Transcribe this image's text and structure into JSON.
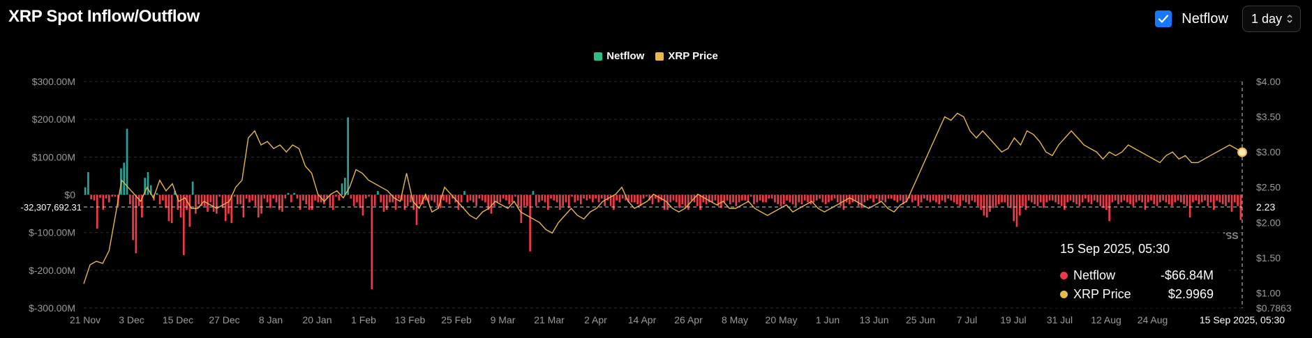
{
  "header": {
    "title": "XRP Spot Inflow/Outflow",
    "netflow_toggle_label": "Netflow",
    "netflow_checked": true,
    "interval_value": "1 day"
  },
  "colors": {
    "netflow_positive": "#26a69a",
    "netflow_negative": "#ef3b48",
    "price_line": "#e8b84a",
    "checkbox": "#1677ff"
  },
  "legend": [
    {
      "label": "Netflow",
      "color": "#2ebd85"
    },
    {
      "label": "XRP Price",
      "color": "#e8b84a"
    }
  ],
  "tooltip": {
    "time": "15 Sep 2025, 05:30",
    "rows": [
      {
        "label": "Netflow",
        "value": "-$66.84M",
        "color": "#ef3b48"
      },
      {
        "label": "XRP Price",
        "value": "$2.9969",
        "color": "#e8b84a"
      }
    ]
  },
  "crosshair": {
    "y_label": "-32,307,692.31",
    "price_label": "2.23",
    "x_label": "15 Sep 2025, 05:30",
    "price_axis_min_label": "$0.7863"
  },
  "watermark": "ISS",
  "chart_data": {
    "type": "bar",
    "title": "XRP Spot Inflow/Outflow",
    "x_tick_labels": [
      "21 Nov",
      "3 Dec",
      "15 Dec",
      "27 Dec",
      "8 Jan",
      "20 Jan",
      "1 Feb",
      "13 Feb",
      "25 Feb",
      "9 Mar",
      "21 Mar",
      "2 Apr",
      "14 Apr",
      "26 Apr",
      "8 May",
      "20 May",
      "1 Jun",
      "13 Jun",
      "25 Jun",
      "7 Jul",
      "19 Jul",
      "31 Jul",
      "12 Aug",
      "24 Aug"
    ],
    "left_axis": {
      "ticks": [
        300,
        200,
        100,
        0,
        -100,
        -200,
        -300
      ],
      "tick_labels": [
        "$300.00M",
        "$200.00M",
        "$100.00M",
        "$0",
        "$-100.00M",
        "$-200.00M",
        "$-300.00M"
      ],
      "ylim": [
        -300,
        300
      ],
      "unit": "M USD"
    },
    "right_axis": {
      "ticks": [
        4.0,
        3.5,
        3.0,
        2.5,
        2.0,
        1.5,
        1.0
      ],
      "tick_labels": [
        "$4.00",
        "$3.50",
        "$3.00",
        "$2.50",
        "$2.00",
        "$1.50",
        "$1.00"
      ],
      "ylim": [
        0.7863,
        4.0
      ]
    },
    "grid": true,
    "legend_position": "top-center",
    "series": [
      {
        "name": "Netflow",
        "axis": "left",
        "kind": "bar",
        "values": [
          20,
          60,
          -12,
          -15,
          -90,
          -8,
          -40,
          -10,
          -20,
          -5,
          -5,
          -30,
          70,
          85,
          175,
          -25,
          -120,
          -155,
          -30,
          -60,
          45,
          60,
          25,
          -15,
          5,
          -25,
          -15,
          -35,
          -70,
          -75,
          10,
          -40,
          -60,
          -160,
          -40,
          -85,
          35,
          -50,
          -25,
          -30,
          -30,
          -45,
          -20,
          -45,
          -50,
          -5,
          -35,
          -70,
          -50,
          -75,
          -5,
          -25,
          -25,
          -60,
          -10,
          -20,
          -15,
          -30,
          -60,
          -50,
          -10,
          -20,
          -35,
          -10,
          -20,
          -40,
          -45,
          -10,
          5,
          -20,
          5,
          -10,
          -40,
          -15,
          -25,
          -40,
          -40,
          -15,
          -20,
          -20,
          -25,
          -10,
          -30,
          -40,
          -5,
          -15,
          30,
          45,
          205,
          -10,
          -30,
          -20,
          -35,
          -55,
          -10,
          -5,
          -250,
          -30,
          10,
          -20,
          -45,
          -40,
          -20,
          -20,
          -40,
          -10,
          -15,
          -40,
          -30,
          -20,
          -40,
          -80,
          -25,
          -25,
          -15,
          -20,
          -15,
          -20,
          -30,
          -35,
          -15,
          -20,
          -25,
          -10,
          -20,
          -40,
          -20,
          10,
          -20,
          -15,
          -20,
          -30,
          -10,
          -15,
          -20,
          -40,
          -50,
          -30,
          -20,
          -20,
          -10,
          -15,
          -25,
          -20,
          -5,
          -30,
          -75,
          -30,
          -30,
          -150,
          10,
          -30,
          -20,
          -15,
          -20,
          -40,
          -10,
          -15,
          -20,
          -40,
          -30,
          -20,
          -35,
          -5,
          -20,
          -15,
          -25,
          -10,
          -15,
          -10,
          -20,
          -10,
          -20,
          -10,
          -30,
          -15,
          -30,
          -40,
          -15,
          -20,
          -10,
          -15,
          -20,
          -20,
          -20,
          -25,
          -30,
          -10,
          -5,
          -15,
          -25,
          -10,
          -20,
          -15,
          -40,
          -40,
          -20,
          -15,
          -20,
          -35,
          -25,
          -35,
          -40,
          -15,
          -20,
          -30,
          -40,
          -20,
          -25,
          -20,
          -20,
          -15,
          -30,
          -35,
          -20,
          -15,
          -25,
          -20,
          -30,
          -20,
          -15,
          -15,
          -20,
          -5,
          -25,
          -20,
          -15,
          -20,
          -20,
          -10,
          -10,
          -20,
          -25,
          -30,
          -25,
          -15,
          -20,
          -25,
          -30,
          -20,
          -25,
          -15,
          -20,
          -25,
          -20,
          -15,
          -10,
          -20,
          -25,
          -20,
          -15,
          -10,
          -20,
          -30,
          -40,
          -20,
          -25,
          -20,
          -15,
          -30,
          -35,
          -20,
          -15,
          -10,
          -20,
          -10,
          -20,
          -15,
          -20,
          -10,
          -10,
          -15,
          -20,
          -15,
          -25,
          -20,
          -10,
          -20,
          -15,
          -30,
          -20,
          -10,
          -15,
          -20,
          -15,
          -20,
          -25,
          -15,
          -20,
          -10,
          -15,
          -20,
          -25,
          -30,
          -15,
          -20,
          -25,
          -15,
          -20,
          -30,
          -40,
          -55,
          -60,
          -45,
          -35,
          -30,
          -25,
          -20,
          -20,
          -30,
          -35,
          -70,
          -85,
          -55,
          -30,
          -40,
          -15,
          -20,
          -25,
          -30,
          -20,
          -35,
          -20,
          -15,
          -15,
          -20,
          -25,
          -30,
          -40,
          -20,
          -15,
          -20,
          -25,
          -30,
          -20,
          -10,
          -20,
          -25,
          -15,
          -20,
          -30,
          -35,
          -40,
          -70,
          -20,
          -15,
          -25,
          -20,
          -15,
          -20,
          -25,
          -30,
          -20,
          -15,
          -20,
          -40,
          -20,
          -15,
          -25,
          -30,
          -20,
          -15,
          -20,
          -25,
          -30,
          -20,
          -15,
          -20,
          -25,
          -30,
          -60,
          -20,
          -15,
          -25,
          -20,
          -15,
          -30,
          -20,
          -40,
          -15,
          -20,
          -25,
          -30,
          -20,
          -45,
          -20,
          -30,
          -66.84
        ]
      },
      {
        "name": "XRP Price",
        "axis": "right",
        "kind": "line",
        "values": [
          1.13,
          1.4,
          1.45,
          1.42,
          1.6,
          2.1,
          2.6,
          2.5,
          2.4,
          2.3,
          2.5,
          2.35,
          2.6,
          2.45,
          2.55,
          2.3,
          2.35,
          2.2,
          2.2,
          2.3,
          2.25,
          2.2,
          2.25,
          2.3,
          2.5,
          2.6,
          3.2,
          3.3,
          3.1,
          3.15,
          3.05,
          3.1,
          3.0,
          3.1,
          3.05,
          2.8,
          2.7,
          2.4,
          2.3,
          2.4,
          2.45,
          2.35,
          2.5,
          2.75,
          2.7,
          2.6,
          2.55,
          2.5,
          2.45,
          2.35,
          2.3,
          2.7,
          2.3,
          2.2,
          2.4,
          2.15,
          2.2,
          2.5,
          2.4,
          2.3,
          2.2,
          2.1,
          2.05,
          2.15,
          2.2,
          2.3,
          2.25,
          2.2,
          2.3,
          2.15,
          2.1,
          2.05,
          2.0,
          1.9,
          1.85,
          2.0,
          2.1,
          2.2,
          2.1,
          2.05,
          2.15,
          2.2,
          2.3,
          2.35,
          2.4,
          2.5,
          2.3,
          2.2,
          2.25,
          2.3,
          2.4,
          2.35,
          2.3,
          2.2,
          2.15,
          2.2,
          2.3,
          2.4,
          2.35,
          2.3,
          2.25,
          2.3,
          2.2,
          2.2,
          2.25,
          2.3,
          2.2,
          2.15,
          2.1,
          2.15,
          2.2,
          2.25,
          2.15,
          2.2,
          2.25,
          2.3,
          2.2,
          2.15,
          2.2,
          2.25,
          2.3,
          2.35,
          2.3,
          2.25,
          2.2,
          2.25,
          2.3,
          2.2,
          2.15,
          2.25,
          2.3,
          2.5,
          2.7,
          2.9,
          3.1,
          3.3,
          3.5,
          3.45,
          3.55,
          3.5,
          3.3,
          3.2,
          3.3,
          3.2,
          3.1,
          3.0,
          3.05,
          3.2,
          3.1,
          3.3,
          3.25,
          3.15,
          3.0,
          2.95,
          3.1,
          3.2,
          3.3,
          3.2,
          3.1,
          3.05,
          3.0,
          2.9,
          3.0,
          2.95,
          3.0,
          3.1,
          3.05,
          3.0,
          2.95,
          2.9,
          2.85,
          2.95,
          3.0,
          2.9,
          2.95,
          2.85,
          2.85,
          2.9,
          2.95,
          3.0,
          3.05,
          3.1,
          3.05,
          2.9969
        ]
      }
    ]
  }
}
